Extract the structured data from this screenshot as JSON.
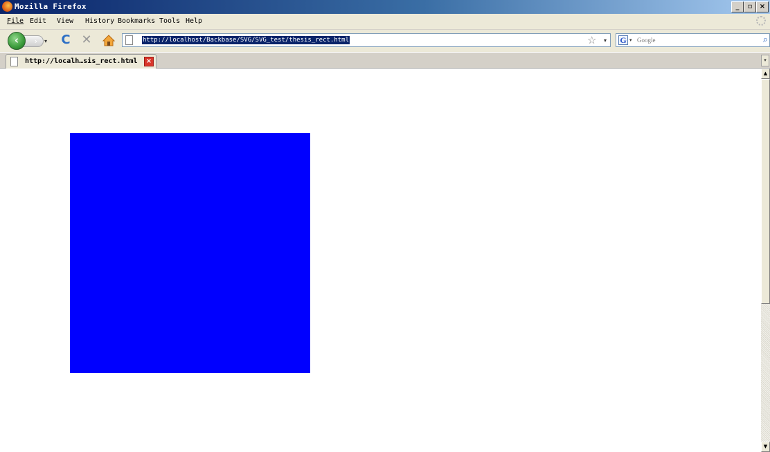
{
  "window": {
    "title": "Mozilla Firefox",
    "minimize": "_",
    "maximize": "▫",
    "close": "×"
  },
  "menu": {
    "items": [
      "File",
      "Edit",
      "View",
      "History",
      "Bookmarks",
      "Tools",
      "Help"
    ]
  },
  "nav": {
    "back_icon": "back-arrow-icon",
    "forward_icon": "forward-arrow-icon",
    "history_dropdown": "▾",
    "reload": "C",
    "stop": "✕",
    "url": "http://localhost/Backbase/SVG/SVG_test/thesis_rect.html",
    "star": "☆",
    "url_dropdown": "▾"
  },
  "search": {
    "engine_letter": "G",
    "placeholder": "Google",
    "go": "⌕"
  },
  "tabs": [
    {
      "label": "http://localh…sis_rect.html",
      "close": "×"
    }
  ],
  "tab_list": "▾",
  "content": {
    "rect_color": "#0000ff"
  },
  "scrollbar": {
    "up": "▲",
    "down": "▼"
  }
}
